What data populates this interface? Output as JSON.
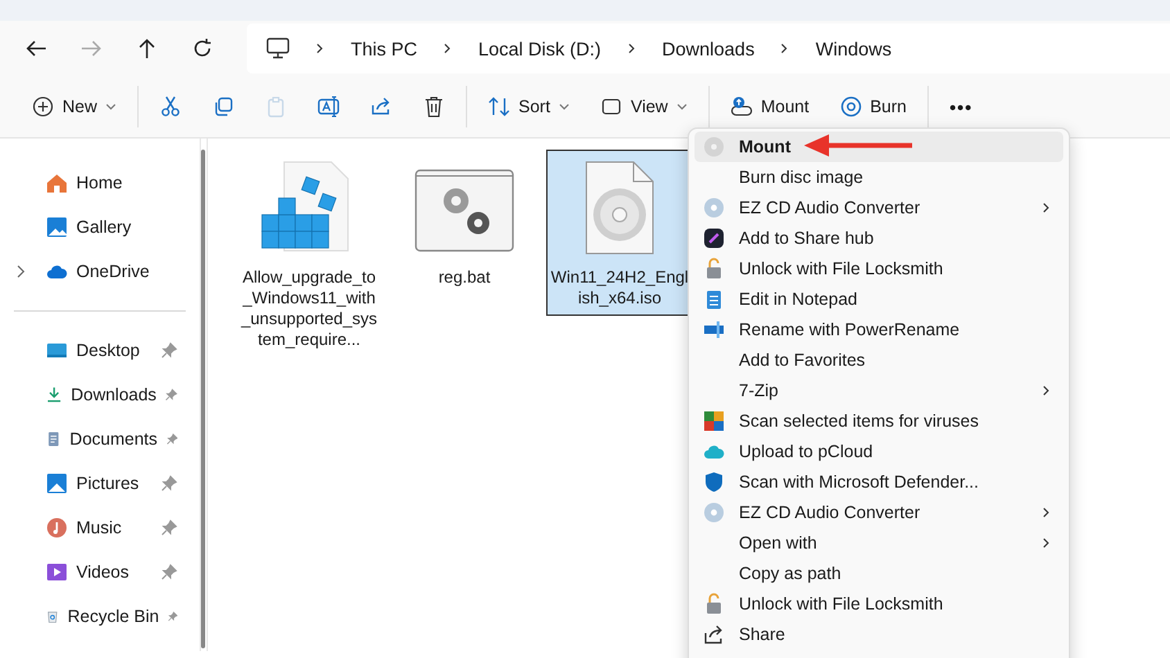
{
  "nav": [
    {
      "disabled": false
    },
    {
      "disabled": true
    },
    {
      "disabled": false
    },
    {
      "disabled": false
    }
  ],
  "breadcrumb": [
    "This PC",
    "Local Disk (D:)",
    "Downloads",
    "Windows"
  ],
  "toolbar": {
    "groups": [
      [
        {
          "label": "New",
          "dropdown": true,
          "disabled": false
        }
      ],
      [
        {
          "dropdown": false,
          "disabled": false
        },
        {
          "dropdown": false,
          "disabled": false
        },
        {
          "dropdown": false,
          "disabled": true
        },
        {
          "dropdown": false,
          "disabled": false
        },
        {
          "dropdown": false,
          "disabled": false
        },
        {
          "dropdown": false,
          "disabled": false
        }
      ],
      [
        {
          "label": "Sort",
          "dropdown": true,
          "disabled": false
        },
        {
          "label": "View",
          "dropdown": true,
          "disabled": false
        }
      ],
      [
        {
          "label": "Mount",
          "dropdown": false,
          "disabled": false
        },
        {
          "label": "Burn",
          "dropdown": false,
          "disabled": false
        }
      ],
      [
        {
          "label": "•••",
          "dropdown": false,
          "disabled": false
        }
      ]
    ]
  },
  "sidebar": {
    "sections": [
      [
        {
          "label": "Home",
          "pinned": false,
          "expandable": false
        },
        {
          "label": "Gallery",
          "pinned": false,
          "expandable": false
        },
        {
          "label": "OneDrive",
          "pinned": false,
          "expandable": true
        }
      ],
      [
        {
          "label": "Desktop",
          "pinned": true,
          "expandable": false
        },
        {
          "label": "Downloads",
          "pinned": true,
          "expandable": false
        },
        {
          "label": "Documents",
          "pinned": true,
          "expandable": false
        },
        {
          "label": "Pictures",
          "pinned": true,
          "expandable": false
        },
        {
          "label": "Music",
          "pinned": true,
          "expandable": false
        },
        {
          "label": "Videos",
          "pinned": true,
          "expandable": false
        },
        {
          "label": "Recycle Bin",
          "pinned": true,
          "expandable": false
        }
      ]
    ]
  },
  "files": [
    {
      "name": "Allow_upgrade_to_Windows11_with_unsupported_system_require...",
      "selected": false
    },
    {
      "name": "reg.bat",
      "selected": false
    },
    {
      "name": "Win11_24H2_English_x64.iso",
      "selected": true
    }
  ],
  "context_menu": {
    "items": [
      {
        "label": "Mount",
        "selected": true,
        "default": true,
        "submenu": false
      },
      {
        "label": "Burn disc image",
        "selected": false,
        "default": false,
        "submenu": false
      },
      {
        "label": "EZ CD Audio Converter",
        "selected": false,
        "default": false,
        "submenu": true
      },
      {
        "label": "Add to Share hub",
        "selected": false,
        "default": false,
        "submenu": false
      },
      {
        "label": "Unlock with File Locksmith",
        "selected": false,
        "default": false,
        "submenu": false
      },
      {
        "label": "Edit in Notepad",
        "selected": false,
        "default": false,
        "submenu": false
      },
      {
        "label": "Rename with PowerRename",
        "selected": false,
        "default": false,
        "submenu": false
      },
      {
        "label": "Add to Favorites",
        "selected": false,
        "default": false,
        "submenu": false
      },
      {
        "label": "7-Zip",
        "selected": false,
        "default": false,
        "submenu": true
      },
      {
        "label": "Scan selected items for viruses",
        "selected": false,
        "default": false,
        "submenu": false
      },
      {
        "label": "Upload to pCloud",
        "selected": false,
        "default": false,
        "submenu": false
      },
      {
        "label": "Scan with Microsoft Defender...",
        "selected": false,
        "default": false,
        "submenu": false
      },
      {
        "label": "EZ CD Audio Converter",
        "selected": false,
        "default": false,
        "submenu": true
      },
      {
        "label": "Open with",
        "selected": false,
        "default": false,
        "submenu": true
      },
      {
        "label": "Copy as path",
        "selected": false,
        "default": false,
        "submenu": false
      },
      {
        "label": "Unlock with File Locksmith",
        "selected": false,
        "default": false,
        "submenu": false
      },
      {
        "label": "Share",
        "selected": false,
        "default": false,
        "submenu": false
      }
    ]
  }
}
